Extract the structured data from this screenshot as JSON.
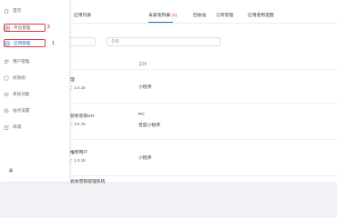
{
  "sidebar": {
    "items": [
      {
        "label": "首页",
        "icon": "home-icon"
      },
      {
        "label": "平台管理",
        "icon": "grid-icon"
      },
      {
        "label": "应用管理",
        "icon": "app-icon"
      },
      {
        "label": "用户管理",
        "icon": "users-icon"
      },
      {
        "label": "权限组",
        "icon": "shield-icon"
      },
      {
        "label": "系统功能",
        "icon": "layers-icon"
      },
      {
        "label": "站点设置",
        "icon": "gear-icon"
      },
      {
        "label": "商城",
        "icon": "store-icon"
      }
    ],
    "markers": [
      "2",
      "1"
    ],
    "bottom_icon": "lock-icon"
  },
  "tabs": {
    "items": [
      {
        "label": "应用列表"
      },
      {
        "label": "未安装列表",
        "count": "(4)"
      },
      {
        "label": "回收站"
      },
      {
        "label": "订阅管理"
      },
      {
        "label": "应用使用提醒"
      }
    ]
  },
  "filter": {
    "chevron": "chevron-down-icon"
  },
  "search": {
    "placeholder": "名称"
  },
  "table": {
    "support_header": "支持",
    "rows": [
      {
        "name": "理",
        "version": "：2.4.16",
        "support": [
          "小程序"
        ]
      },
      {
        "name": "装修装修DIY",
        "version": "：3.2.76",
        "support": [
          "PC",
          "百度小程序"
        ]
      },
      {
        "name": "推荐用户",
        "version": "：1.3.18",
        "support": [
          "小程序"
        ]
      },
      {
        "name": "会体营销管理系统",
        "version": "",
        "support": []
      }
    ]
  },
  "colors": {
    "accent": "#1f6fe5",
    "highlight": "#e0383e"
  }
}
